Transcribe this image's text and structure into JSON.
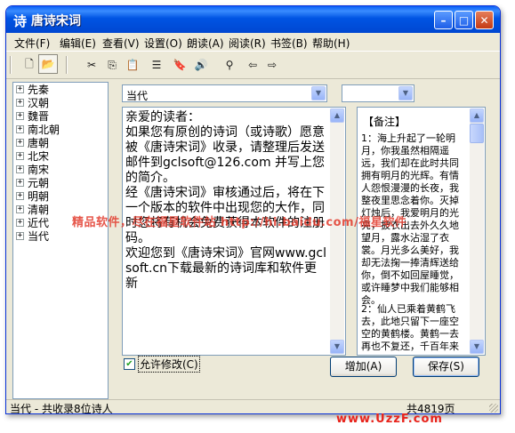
{
  "window": {
    "app_icon_glyph": "诗",
    "title": "唐诗宋词",
    "controls": {
      "minimize": "–",
      "maximize": "□",
      "close": "✕"
    }
  },
  "menu": [
    "文件(F)",
    "编辑(E)",
    "查看(V)",
    "设置(O)",
    "朗读(A)",
    "阅读(R)",
    "书签(B)",
    "帮助(H)"
  ],
  "toolbar": {
    "icons": [
      "new-file-icon",
      "open-folder-icon",
      "cut-icon",
      "copy-icon",
      "paste-icon",
      "list-icon",
      "bookmark-icon",
      "read-aloud-icon",
      "find-icon",
      "back-arrow-icon",
      "forward-arrow-icon"
    ],
    "glyphs": {
      "new": "🗋",
      "open": "📂",
      "cut": "✂",
      "copy": "⎘",
      "paste": "📋",
      "list": "☰",
      "bookmark": "🔖",
      "speak": "🔊",
      "find": "⚲",
      "back": "⇦",
      "forward": "⇨"
    }
  },
  "tree": [
    {
      "label": "先秦",
      "expander": "+"
    },
    {
      "label": "汉朝",
      "expander": "+"
    },
    {
      "label": "魏晋",
      "expander": "+"
    },
    {
      "label": "南北朝",
      "expander": "+"
    },
    {
      "label": "唐朝",
      "expander": "+"
    },
    {
      "label": "北宋",
      "expander": "+"
    },
    {
      "label": "南宋",
      "expander": "+"
    },
    {
      "label": "元朝",
      "expander": "+"
    },
    {
      "label": "明朝",
      "expander": "+"
    },
    {
      "label": "清朝",
      "expander": "+"
    },
    {
      "label": "近代",
      "expander": "+"
    },
    {
      "label": "当代",
      "expander": "+"
    }
  ],
  "dropdowns": {
    "primary": {
      "value": "当代",
      "arrow": "▼"
    },
    "secondary": {
      "value": "",
      "arrow": "▼"
    }
  },
  "editor": {
    "text": "亲爱的读者：\n如果您有原创的诗词（或诗歌）愿意被《唐诗宋词》收录，请整理后发送邮件到gclsoft@126.com 并写上您的简介。\n经《唐诗宋词》审核通过后，将在下一个版本的软件中出现您的大作，同时您将有机会免费获得本软件的注册码。\n欢迎您到《唐诗宋词》官网www.gclsoft.cn下载最新的诗词库和软件更新",
    "scroll_arrows": {
      "up": "▲",
      "down": "▼"
    }
  },
  "notes": {
    "heading": "【备注】",
    "entries": [
      "1：海上升起了一轮明月，你我虽然相隔遥远，我们却在此时共同拥有明月的光辉。有情人怨恨漫漫的长夜，我整夜里思念着你。灭掉灯烛后，我爱明月的光亮，披衣出去外久久地望月，露水沾湿了衣裳。月光多么美好，我却无法掬一捧清辉送给你，倒不如回屋睡觉，或许睡梦中我们能够相会。",
      "2：仙人已乘着黄鹤飞去，此地只留下一座空空的黄鹤楼。黄鹤一去再也不复还，千百年来"
    ],
    "scroll_arrows": {
      "up": "▲",
      "down": "▼"
    }
  },
  "watermark": "精品软件，尽在福星软件站 http://hi.baidu.com/福星软件",
  "checkbox": {
    "label": "允许修改(C)",
    "checked": true,
    "mark": "✔"
  },
  "buttons": {
    "add": "增加(A)",
    "save": "保存(S)"
  },
  "status": {
    "left": "当代 - 共收录8位诗人",
    "right": "共4819页"
  },
  "site_mark": "www.UzzF.com",
  "colors": {
    "titlebar": "#0054e3",
    "watermark": "#e23a2c",
    "site_mark": "#e8231b"
  }
}
